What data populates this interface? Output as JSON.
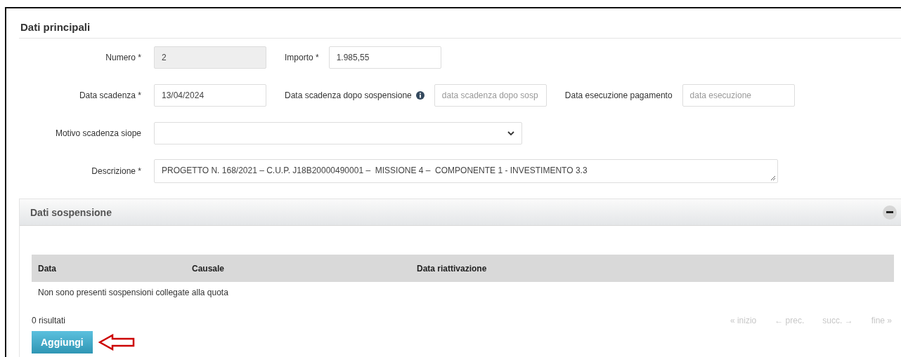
{
  "main_section": {
    "title": "Dati principali"
  },
  "form_rows": [
    {
      "fields": [
        {
          "kind": "input",
          "label": "Numero *",
          "value": "2",
          "readonly": true
        },
        {
          "kind": "input",
          "label": "Importo *",
          "value": "1.985,55",
          "readonly": false
        }
      ]
    },
    {
      "fields": [
        {
          "kind": "input",
          "label": "Data scadenza *",
          "value": "13/04/2024",
          "readonly": false
        },
        {
          "kind": "input",
          "label": "Data scadenza dopo sospensione",
          "info": true,
          "placeholder": "data scadenza dopo sosp",
          "readonly": false
        },
        {
          "kind": "input",
          "label": "Data esecuzione pagamento",
          "placeholder": "data esecuzione",
          "readonly": false
        }
      ]
    },
    {
      "fields": [
        {
          "kind": "select",
          "label": "Motivo scadenza siope"
        }
      ]
    },
    {
      "fields": [
        {
          "kind": "textarea",
          "label": "Descrizione *",
          "value": "PROGETTO N. 168/2021 – C.U.P. J18B20000490001 –  MISSIONE 4 –  COMPONENTE 1 - INVESTIMENTO 3.3"
        }
      ]
    }
  ],
  "suspension_panel": {
    "title": "Dati sospensione",
    "expanded": true,
    "table": {
      "columns": [
        "Data",
        "Causale",
        "Data riattivazione"
      ],
      "empty_message": "Non sono presenti sospensioni collegate alla quota"
    },
    "result_count": "0 risultati",
    "pagination": [
      {
        "label": "« inizio",
        "disabled": true
      },
      {
        "label": "← prec.",
        "disabled": true
      },
      {
        "label": "succ. →",
        "disabled": true
      },
      {
        "label": "fine »",
        "disabled": true
      }
    ],
    "add_button": "Aggiungi"
  }
}
